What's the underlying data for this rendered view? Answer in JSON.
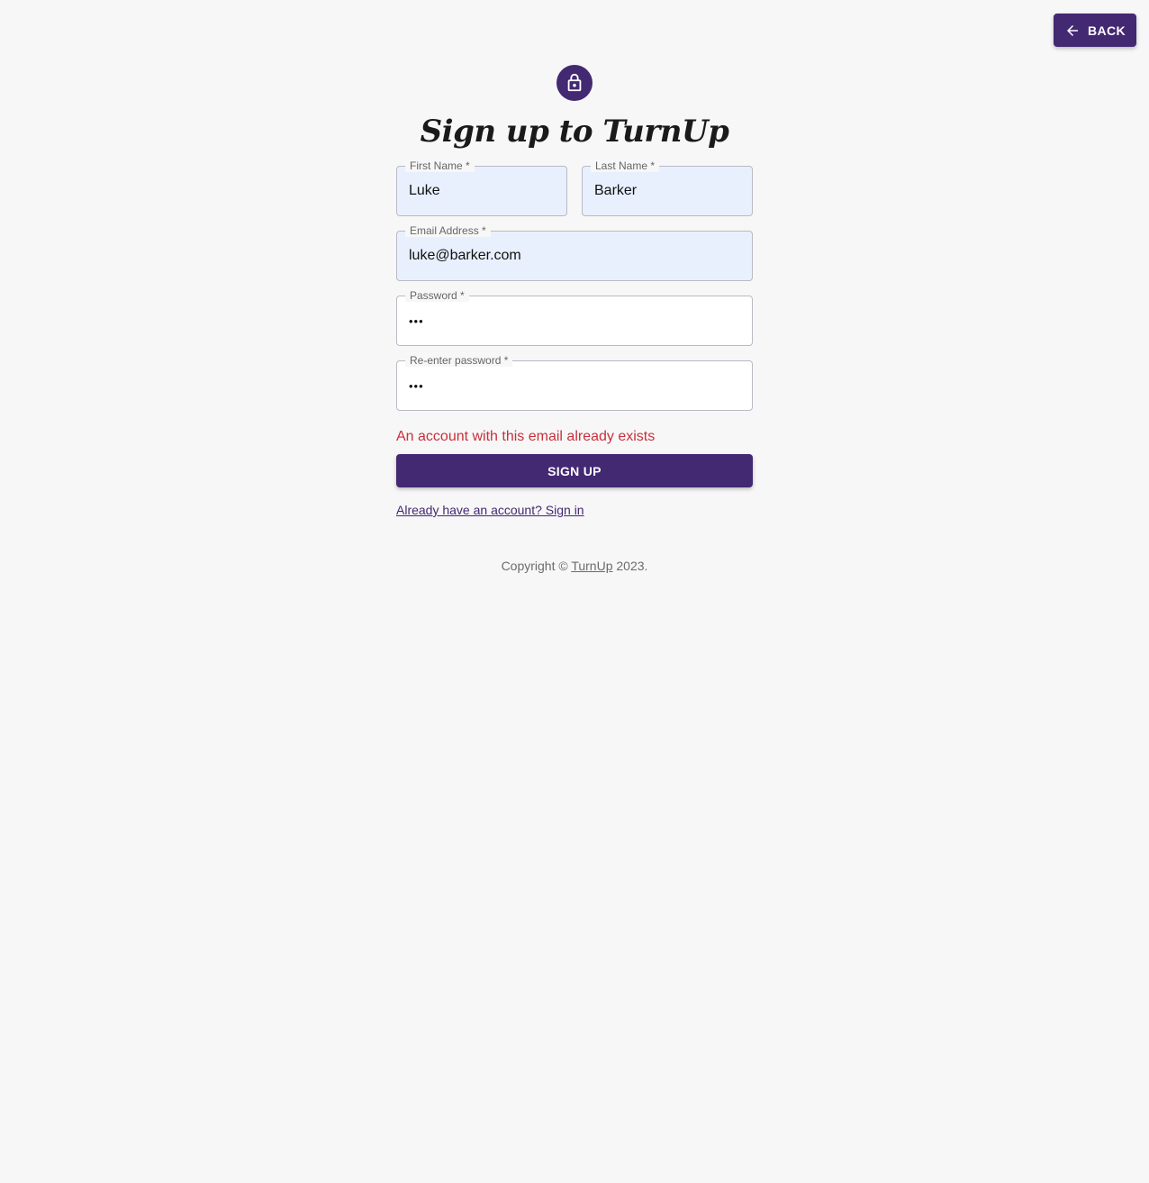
{
  "header": {
    "back_label": "BACK",
    "back_icon": "arrow-left-icon"
  },
  "brand": {
    "avatar_icon": "lock-icon",
    "title": "Sign up to TurnUp",
    "accent_color": "#432872",
    "error_color": "#c8303c",
    "autofill_color": "#e8f0fe"
  },
  "form": {
    "first_name": {
      "label": "First Name *",
      "value": "Luke"
    },
    "last_name": {
      "label": "Last Name *",
      "value": "Barker"
    },
    "email": {
      "label": "Email Address *",
      "value": "luke@barker.com"
    },
    "password": {
      "label": "Password *",
      "value": "•••"
    },
    "reenter_password": {
      "label": "Re-enter password *",
      "value": "•••"
    },
    "error_message": "An account with this email already exists",
    "submit_label": "SIGN UP",
    "signin_link": "Already have an account? Sign in"
  },
  "footer": {
    "prefix": "Copyright © ",
    "link": "TurnUp",
    "suffix": " 2023."
  }
}
